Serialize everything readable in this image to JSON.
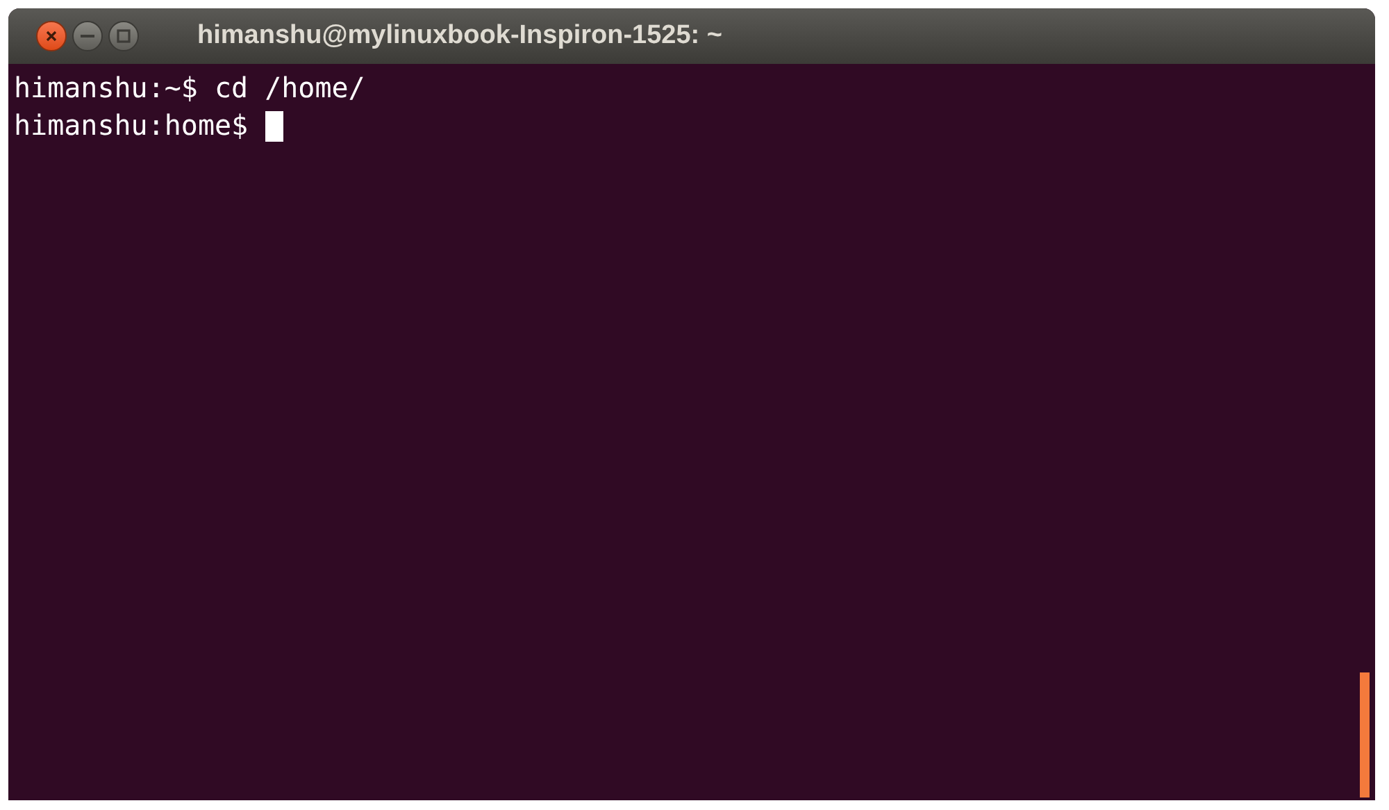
{
  "window": {
    "title": "himanshu@mylinuxbook-Inspiron-1525: ~"
  },
  "terminal": {
    "lines": [
      {
        "prompt": "himanshu:~$",
        "command": "cd /home/",
        "cursor": false
      },
      {
        "prompt": "himanshu:home$",
        "cursor": true
      }
    ]
  }
}
